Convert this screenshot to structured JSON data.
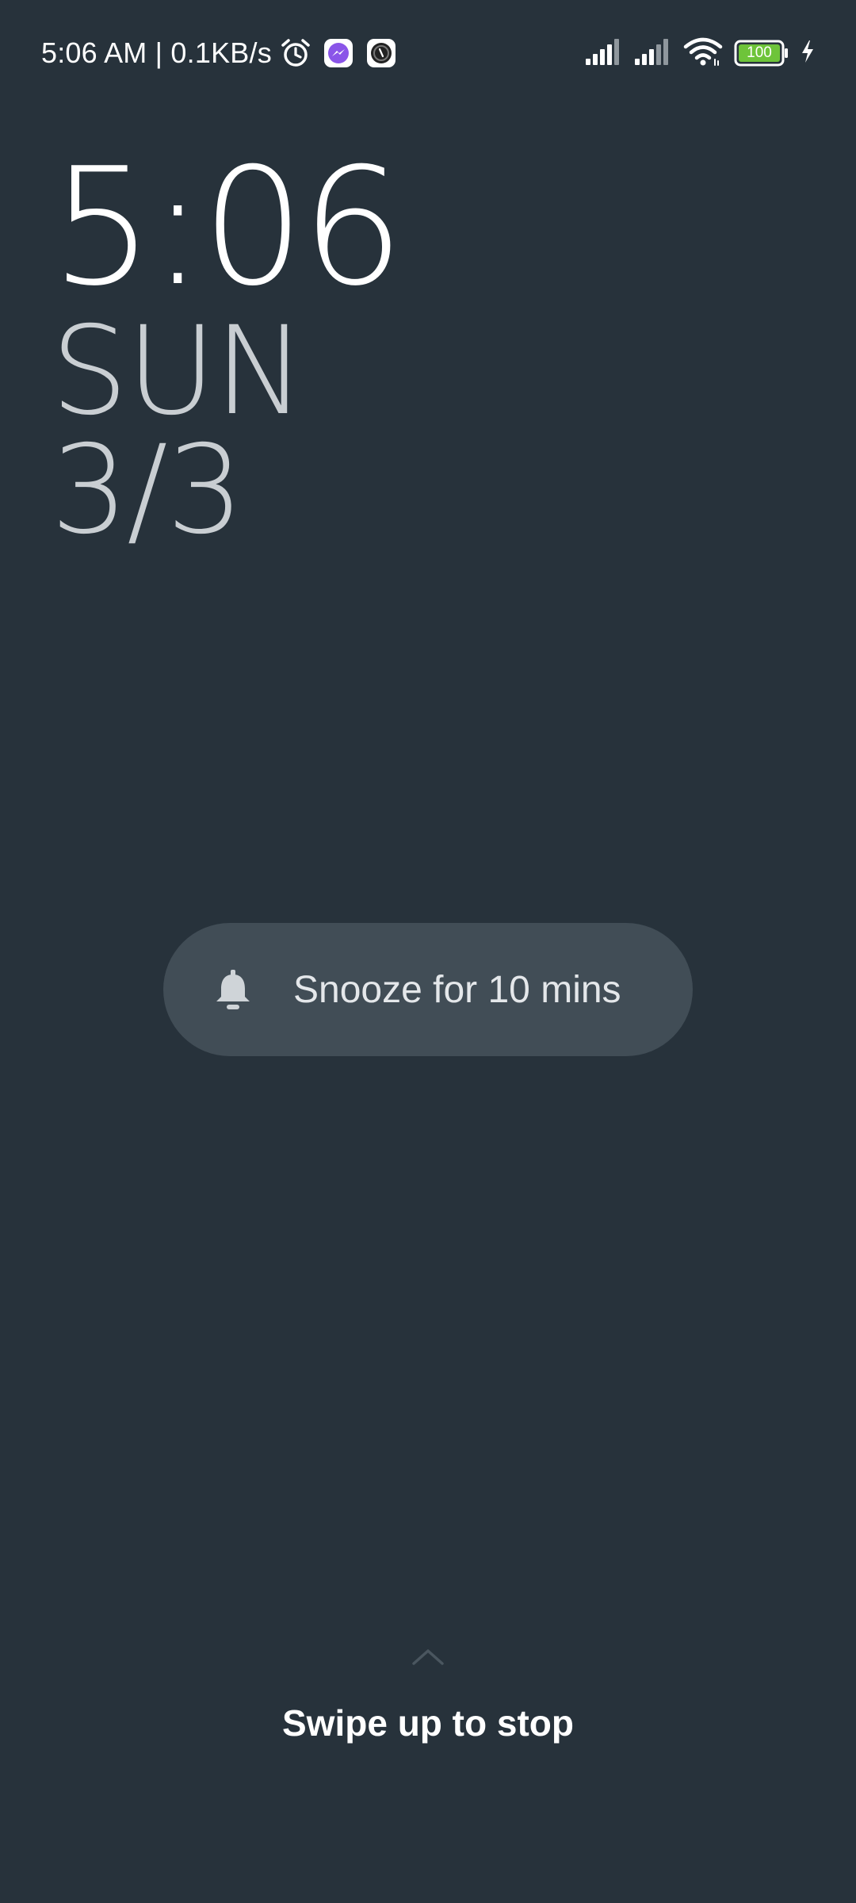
{
  "status_bar": {
    "time_and_speed": "5:06 AM | 0.1KB/s",
    "battery_level": "100",
    "icons_left": [
      "alarm-icon",
      "messenger-icon",
      "app-icon"
    ],
    "icons_right": [
      "signal-icon",
      "signal-icon",
      "wifi-icon",
      "battery-icon",
      "charging-icon"
    ],
    "battery_color": "#6ec43a"
  },
  "clock": {
    "time": "5:06",
    "day": "SUN",
    "date": "3/3"
  },
  "snooze": {
    "icon": "bell-icon",
    "label": "Snooze for 10 mins"
  },
  "swipe": {
    "icon": "chevron-up-icon",
    "label": "Swipe up to stop"
  },
  "colors": {
    "background": "#27323b",
    "pill": "#414d56"
  }
}
